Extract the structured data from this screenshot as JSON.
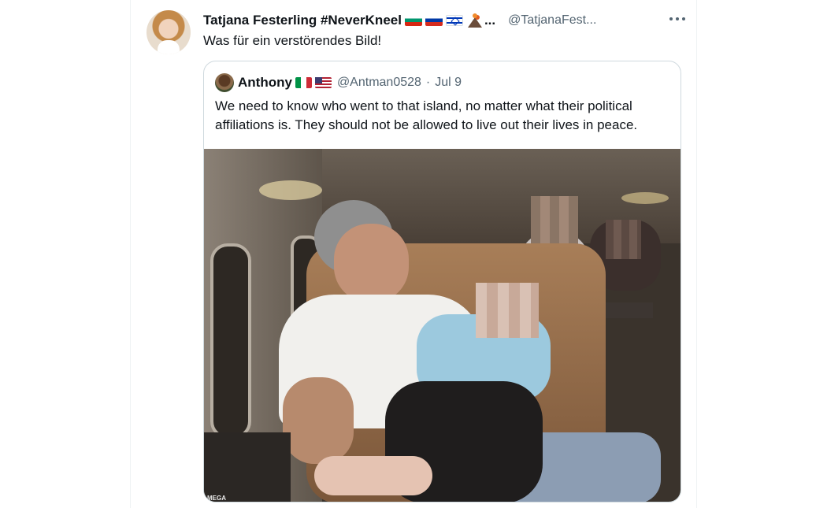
{
  "tweet": {
    "author_name": "Tatjana Festerling #NeverKneel",
    "handle": "@TatjanaFest...",
    "text": "Was für ein verstörendes Bild!"
  },
  "quoted_tweet": {
    "author_name": "Anthony",
    "handle": "@Antman0528",
    "date": "Jul 9",
    "text": "We need to know who went to that island, no matter what their political affiliations is. They should not be allowed to live out their lives in peace."
  },
  "photo": {
    "watermark": "MEGA"
  },
  "icons": [
    "more-icon",
    "flag-bulgaria-icon",
    "flag-russia-icon",
    "flag-israel-icon",
    "volcano-icon",
    "flag-italy-icon",
    "flag-usa-icon"
  ]
}
